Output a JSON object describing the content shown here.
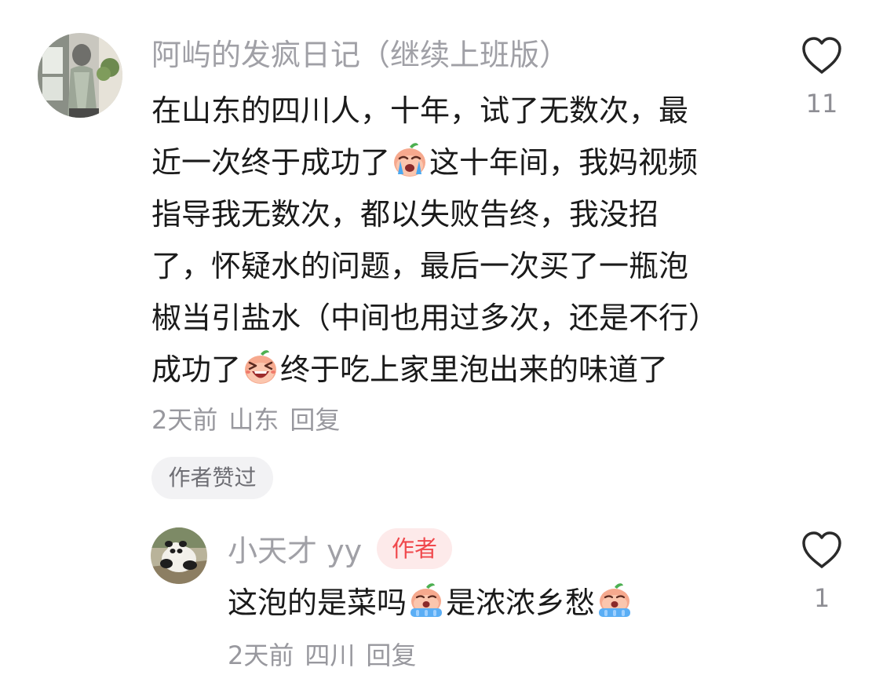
{
  "comment": {
    "username": "阿屿的发疯日记（继续上班版）",
    "lines": [
      [
        "在山东的四川人，十年，试了无数次，最"
      ],
      [
        "近一次终于成功了",
        "这十年间，我妈视频"
      ],
      [
        "指导我无数次，都以失败告终，我没招"
      ],
      [
        "了，怀疑水的问题，最后一次买了一瓶泡"
      ],
      [
        "椒当引盐水（中间也用过多次，还是不行）"
      ],
      [
        "成功了",
        "终于吃上家里泡出来的味道了"
      ]
    ],
    "time": "2天前",
    "location": "山东",
    "reply_label": "回复",
    "liked_chip": "作者赞过",
    "like_count": "11",
    "emojis": [
      "crying-face-emoji",
      "laughing-face-emoji"
    ]
  },
  "reply": {
    "username": "小天才 yy",
    "author_badge": "作者",
    "text_parts": [
      "这泡的是菜吗",
      "是浓浓乡愁"
    ],
    "time": "2天前",
    "location": "四川",
    "reply_label": "回复",
    "like_count": "1",
    "emojis": [
      "sobbing-face-emoji",
      "sobbing-face-emoji"
    ]
  },
  "colors": {
    "text": "#1a1a1a",
    "username": "#a0a0a6",
    "meta": "#98989e",
    "badge_bg": "#fdeaea",
    "badge_text": "#f0484c",
    "chip_bg": "#f2f2f4",
    "icon": "#2a2a2a"
  }
}
